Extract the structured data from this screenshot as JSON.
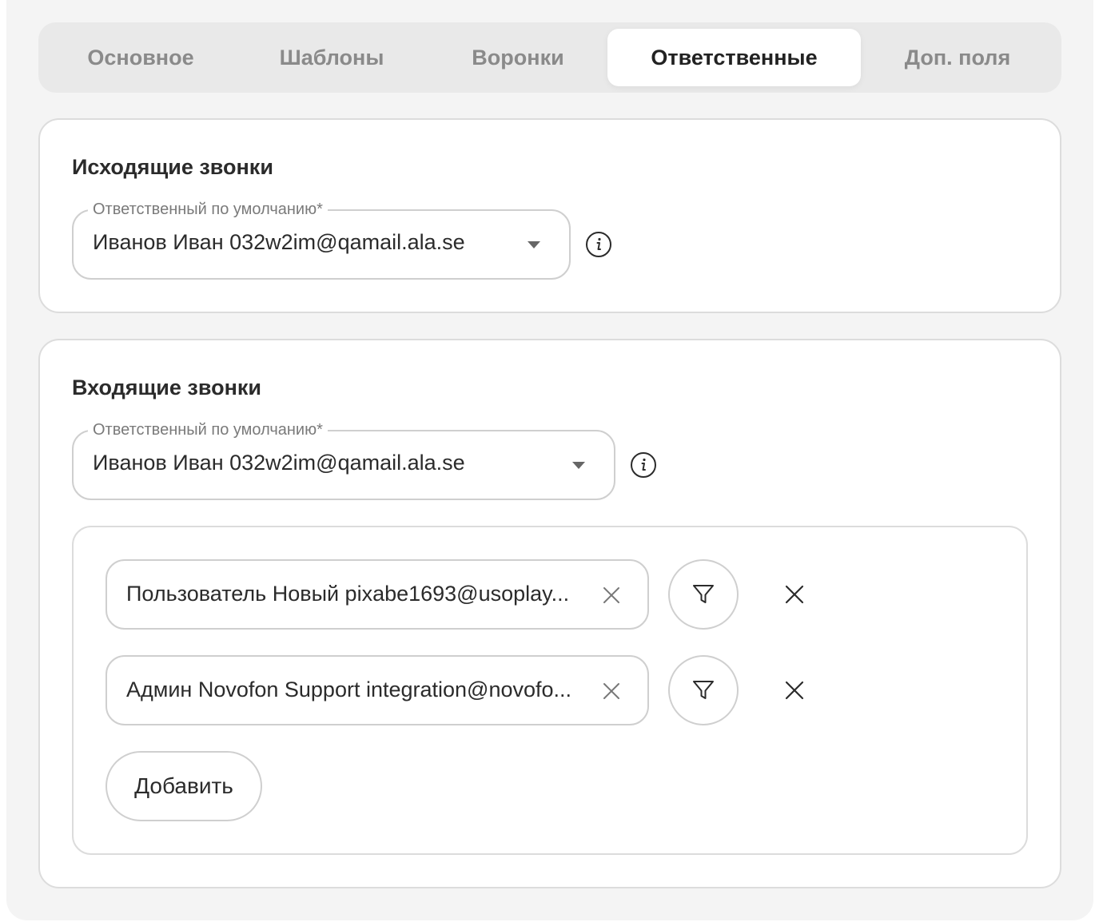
{
  "tabs": [
    {
      "label": "Основное",
      "active": false
    },
    {
      "label": "Шаблоны",
      "active": false
    },
    {
      "label": "Воронки",
      "active": false
    },
    {
      "label": "Ответственные",
      "active": true
    },
    {
      "label": "Доп. поля",
      "active": false
    }
  ],
  "outgoing": {
    "title": "Исходящие звонки",
    "field_label": "Ответственный по умолчанию*",
    "field_value": "Иванов Иван 032w2im@qamail.ala.se",
    "info_icon": "info-icon"
  },
  "incoming": {
    "title": "Входящие звонки",
    "field_label": "Ответственный по умолчанию*",
    "field_value": "Иванов Иван 032w2im@qamail.ala.se",
    "info_icon": "info-icon",
    "rules": [
      {
        "value": "Пользователь Новый pixabe1693@usoplay..."
      },
      {
        "value": "Админ Novofon Support integration@novofo..."
      }
    ],
    "add_label": "Добавить"
  },
  "colors": {
    "panel_bg": "#f4f4f4",
    "tabs_bg": "#e9e9e9",
    "active_tab_bg": "#ffffff",
    "border": "#dcdcdc",
    "text": "#2b2b2b",
    "muted": "#8a8a8a"
  }
}
